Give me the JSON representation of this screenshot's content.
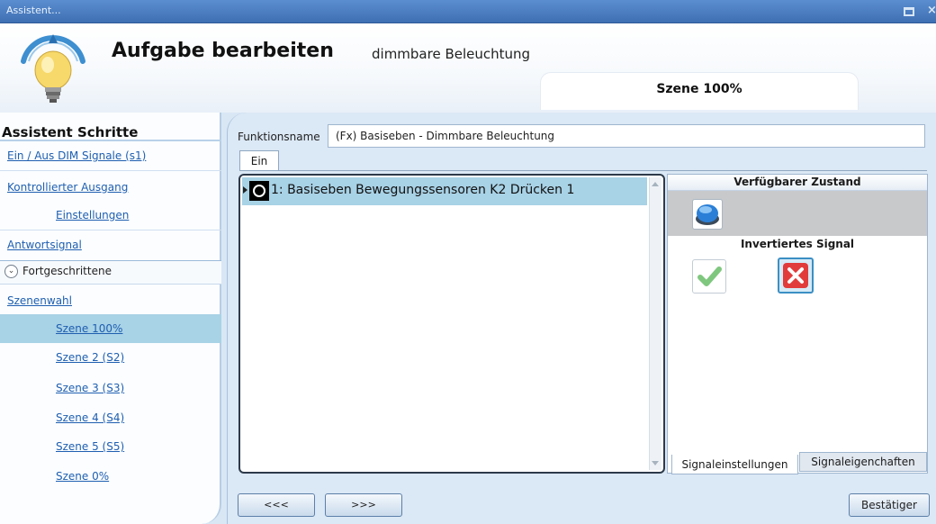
{
  "window": {
    "title": "Assistent..."
  },
  "header": {
    "title": "Aufgabe bearbeiten",
    "subtitle": "dimmbare Beleuchtung",
    "scene_tab": "Szene 100%"
  },
  "nav": {
    "title": "Assistent Schritte",
    "items": [
      {
        "label": "Ein / Aus DIM Signale (s1)"
      },
      {
        "label": "Kontrollierter Ausgang"
      },
      {
        "label": "Einstellungen"
      },
      {
        "label": "Antwortsignal"
      }
    ],
    "advanced": {
      "label": "Fortgeschrittene"
    },
    "scene_select": {
      "label": "Szenenwahl"
    },
    "scenes": [
      {
        "label": "Szene 100%",
        "selected": true
      },
      {
        "label": "Szene 2 (S2)"
      },
      {
        "label": "Szene 3 (S3)"
      },
      {
        "label": "Szene 4 (S4)"
      },
      {
        "label": "Szene 5 (S5)"
      },
      {
        "label": "Szene 0%"
      }
    ]
  },
  "main": {
    "function_name_label": "Funktionsname",
    "function_name_value": "(Fx) Basiseben - Dimmbare Beleuchtung",
    "tab": "Ein",
    "list": [
      {
        "label": "1: Basiseben Bewegungssensoren K2 Drücken 1"
      }
    ],
    "right": {
      "available_state": "Verfügbarer Zustand",
      "inverted_signal": "Invertiertes Signal",
      "tabs": [
        "Signaleinstellungen",
        "Signaleigenchaften"
      ]
    }
  },
  "buttons": {
    "back": "<<<",
    "next": ">>>",
    "confirm": "Bestätiger"
  },
  "colors": {
    "titlebar": "#4a7fc4",
    "selection": "#a8d2e6",
    "link": "#1f5fb0"
  }
}
